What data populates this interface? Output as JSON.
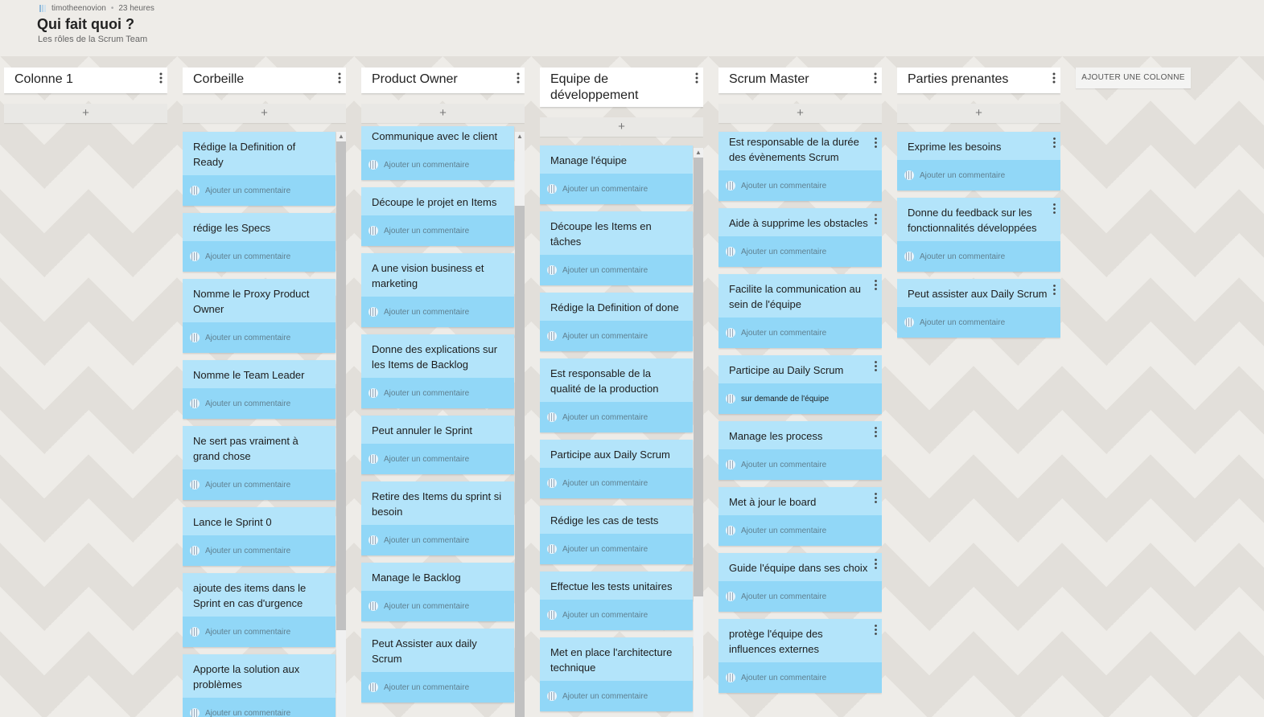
{
  "header": {
    "author": "timotheenovion",
    "time": "23 heures",
    "title": "Qui fait quoi ?",
    "subtitle": "Les rôles de la Scrum Team"
  },
  "add_card_label": "+",
  "add_column_label": "AJOUTER UNE COLONNE",
  "columns": [
    {
      "title": "Colonne 1",
      "cards": []
    },
    {
      "title": "Corbeille",
      "cards": [
        {
          "title": "Rédige la Definition of Ready",
          "comment": "Ajouter un commentaire"
        },
        {
          "title": "rédige les Specs",
          "comment": "Ajouter un commentaire"
        },
        {
          "title": "Nomme le Proxy Product Owner",
          "comment": "Ajouter un commentaire"
        },
        {
          "title": "Nomme le Team Leader",
          "comment": "Ajouter un commentaire"
        },
        {
          "title": "Ne sert pas vraiment à grand chose",
          "comment": "Ajouter un commentaire"
        },
        {
          "title": "Lance le Sprint 0",
          "comment": "Ajouter un commentaire"
        },
        {
          "title": "ajoute des items dans le Sprint en cas d'urgence",
          "comment": "Ajouter un commentaire"
        },
        {
          "title": "Apporte la solution aux problèmes",
          "comment": "Ajouter un commentaire"
        }
      ]
    },
    {
      "title": "Product Owner",
      "cards": [
        {
          "title": "Communique avec le client",
          "comment": "Ajouter un commentaire"
        },
        {
          "title": "Découpe le projet en Items",
          "comment": "Ajouter un commentaire"
        },
        {
          "title": "A une vision business et marketing",
          "comment": "Ajouter un commentaire"
        },
        {
          "title": "Donne des explications sur les Items de Backlog",
          "comment": "Ajouter un commentaire"
        },
        {
          "title": "Peut annuler le Sprint",
          "comment": "Ajouter un commentaire"
        },
        {
          "title": "Retire des Items du sprint si besoin",
          "comment": "Ajouter un commentaire"
        },
        {
          "title": "Manage le Backlog",
          "comment": "Ajouter un commentaire"
        },
        {
          "title": "Peut Assister aux daily Scrum",
          "comment": "Ajouter un commentaire"
        }
      ]
    },
    {
      "title": "Equipe de développement",
      "cards": [
        {
          "title": "Manage l'équipe",
          "comment": "Ajouter un commentaire"
        },
        {
          "title": "Découpe les Items en tâches",
          "comment": "Ajouter un commentaire"
        },
        {
          "title": "Rédige la Definition of done",
          "comment": "Ajouter un commentaire"
        },
        {
          "title": "Est responsable de la qualité de la production",
          "comment": "Ajouter un commentaire"
        },
        {
          "title": "Participe aux Daily Scrum",
          "comment": "Ajouter un commentaire"
        },
        {
          "title": "Rédige les cas de tests",
          "comment": "Ajouter un commentaire"
        },
        {
          "title": "Effectue les tests unitaires",
          "comment": "Ajouter un commentaire"
        },
        {
          "title": "Met en place l'architecture technique",
          "comment": "Ajouter un commentaire"
        }
      ]
    },
    {
      "title": "Scrum Master",
      "cards": [
        {
          "title": "Est responsable de la durée des évènements Scrum",
          "comment": "Ajouter un commentaire"
        },
        {
          "title": "Aide à supprime les obstacles",
          "comment": "Ajouter un commentaire"
        },
        {
          "title": "Facilite la communication au sein de l'équipe",
          "comment": "Ajouter un commentaire"
        },
        {
          "title": "Participe au Daily Scrum",
          "comment": "sur demande de l'équipe"
        },
        {
          "title": "Manage les process",
          "comment": "Ajouter un commentaire"
        },
        {
          "title": "Met à jour le board",
          "comment": "Ajouter un commentaire"
        },
        {
          "title": "Guide l'équipe dans ses choix",
          "comment": "Ajouter un commentaire"
        },
        {
          "title": "protège l'équipe des influences externes",
          "comment": "Ajouter un commentaire"
        }
      ]
    },
    {
      "title": "Parties prenantes",
      "cards": [
        {
          "title": "Exprime les besoins",
          "comment": "Ajouter un commentaire"
        },
        {
          "title": "Donne du feedback sur les fonctionnalités développées",
          "comment": "Ajouter un commentaire"
        },
        {
          "title": "Peut assister aux Daily Scrum",
          "comment": "Ajouter un commentaire"
        }
      ]
    }
  ]
}
